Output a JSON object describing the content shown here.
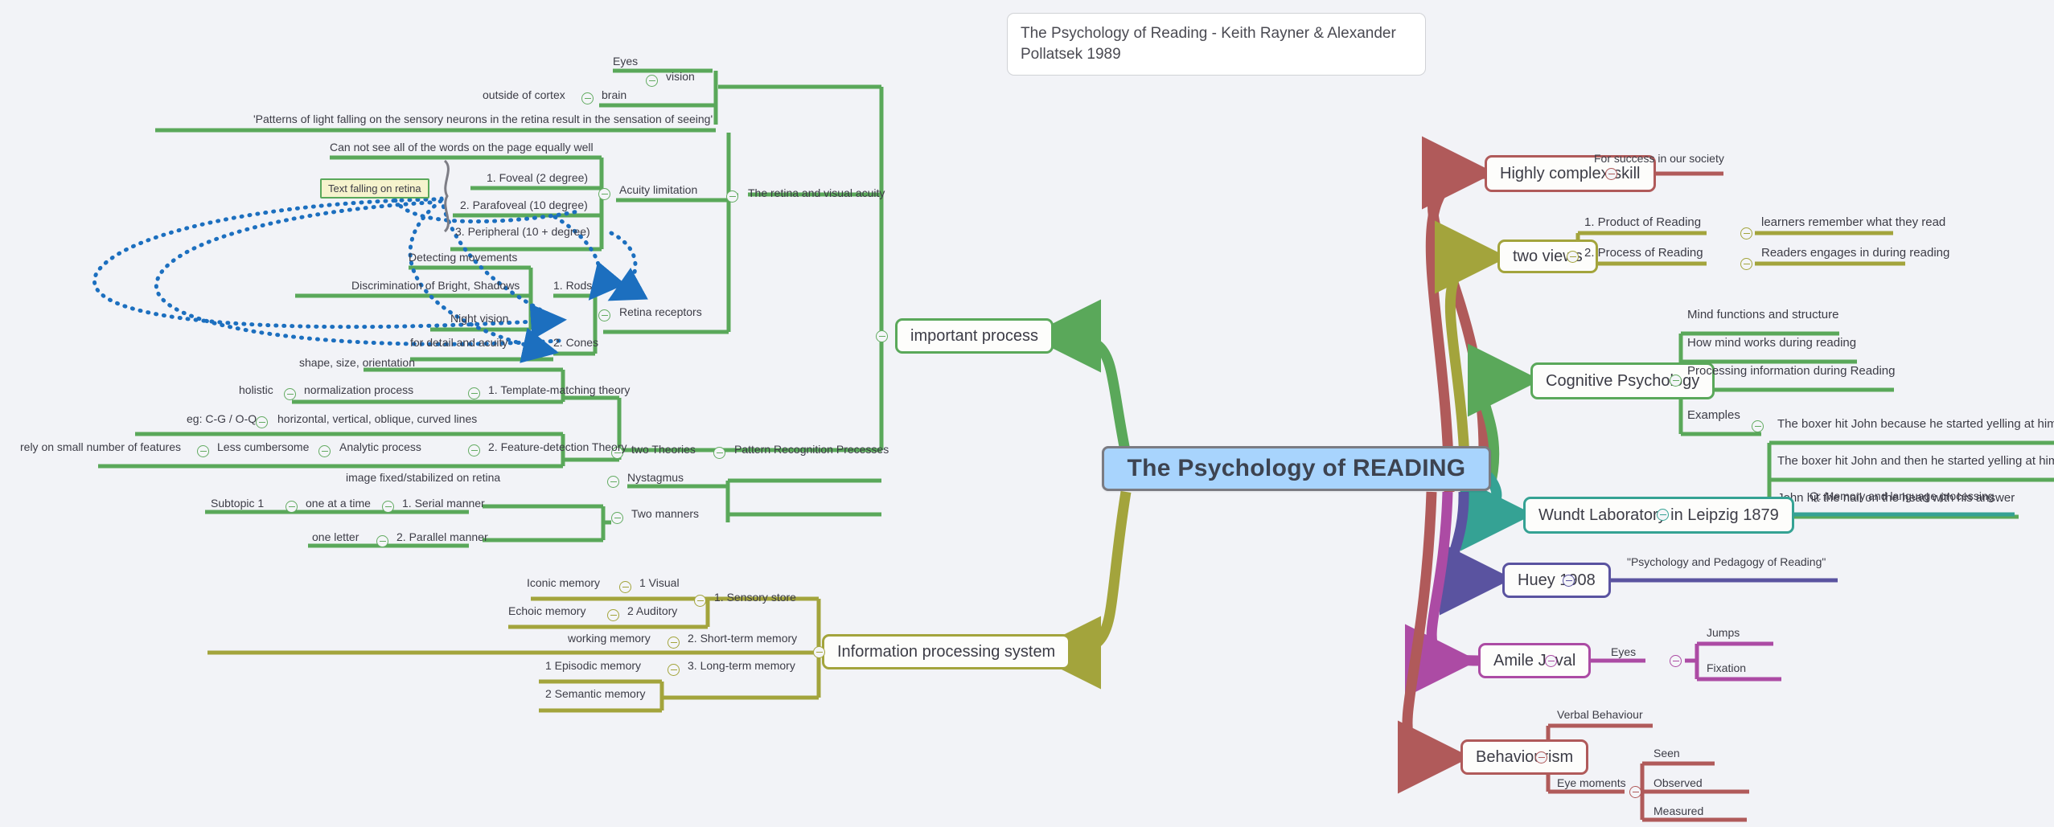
{
  "title_card": {
    "text": "The Psychology of Reading - Keith Rayner & Alexander Pollatsek 1989"
  },
  "root": {
    "label": "The Psychology of READING",
    "fill": "#a8d4fd",
    "border": "#7b7b82"
  },
  "colors": {
    "green": "#5aa85a",
    "olive": "#a3a43c",
    "red": "#b05a5a",
    "teal": "#35a294",
    "purple": "#5a53a0",
    "magenta": "#ac4ba4",
    "relation_blue": "#1c6fbf",
    "background": "#f2f3f7",
    "node_fill": "#fdfdfb",
    "note_fill": "#f6f3cd"
  },
  "right_branches": [
    {
      "label": "Highly complex skill",
      "color": "#b05a5a",
      "children": [
        {
          "label": "For success in our society"
        }
      ]
    },
    {
      "label": "two views",
      "color": "#a3a43c",
      "children": [
        {
          "label": "1. Product of Reading",
          "children": [
            {
              "label": "learners remember what they read"
            }
          ]
        },
        {
          "label": "2. Process of Reading",
          "children": [
            {
              "label": "Readers engages in during reading"
            }
          ]
        }
      ]
    },
    {
      "label": "Cognitive Psychology",
      "color": "#5aa85a",
      "children": [
        {
          "label": "Mind functions and structure"
        },
        {
          "label": "How mind works during reading"
        },
        {
          "label": "Processing information during Reading"
        },
        {
          "label": "Examples",
          "children": [
            {
              "label": "The boxer hit John because he started yelling at him"
            },
            {
              "label": "The boxer hit John and then he started yelling at him"
            },
            {
              "label": "John hit the nail on the head with his answer"
            }
          ]
        }
      ]
    },
    {
      "label": "Wundt Laboratory in Leipzig 1879",
      "color": "#35a294",
      "children": [
        {
          "label": "Q: Memory and language processing"
        }
      ]
    },
    {
      "label": "Huey 1908",
      "color": "#5a53a0",
      "children": [
        {
          "label": "\"Psychology and Pedagogy of Reading\""
        }
      ]
    },
    {
      "label": "Amile Javal",
      "color": "#ac4ba4",
      "children": [
        {
          "label": "Eyes",
          "children": [
            {
              "label": "Jumps"
            },
            {
              "label": "Fixation"
            }
          ]
        }
      ]
    },
    {
      "label": "Behaviourism",
      "color": "#b05a5a",
      "children": [
        {
          "label": "Verbal Behaviour"
        },
        {
          "label": "Eye moments",
          "children": [
            {
              "label": "Seen"
            },
            {
              "label": "Observed"
            },
            {
              "label": "Measured"
            }
          ]
        }
      ]
    }
  ],
  "left_branches": [
    {
      "label": "important process",
      "color": "#5aa85a",
      "children": [
        {
          "label": "vision",
          "children": [
            {
              "label": "brain",
              "children": [
                {
                  "label": "outside of cortex"
                },
                {
                  "label": "Eyes"
                }
              ]
            },
            {
              "label": "'Patterns of light falling on the sensory neurons in the retina result in the sensation of seeing'"
            }
          ]
        },
        {
          "label": "The retina and visual acuity",
          "children": [
            {
              "label": "Acuity limitation",
              "children": [
                {
                  "label": "Can not see all of the words on the page equally well"
                },
                {
                  "label": "1. Foveal (2 degree)"
                },
                {
                  "label": "2. Parafoveal (10 degree)"
                },
                {
                  "label": "3. Peripheral (10 + degree)"
                }
              ]
            },
            {
              "label": "Retina receptors",
              "children": [
                {
                  "label": "1. Rods",
                  "children": [
                    {
                      "label": "Detecting movements"
                    },
                    {
                      "label": "Discrimination of Bright, Shadows"
                    },
                    {
                      "label": "Night vision"
                    }
                  ]
                },
                {
                  "label": "2. Cones",
                  "children": [
                    {
                      "label": "for detail and acuity"
                    }
                  ]
                }
              ]
            }
          ]
        },
        {
          "label": "Pattern Recognition Precesses",
          "children": [
            {
              "label": "two Theories",
              "children": [
                {
                  "label": "1. Template-matching theory",
                  "children": [
                    {
                      "label": "shape, size, orientation"
                    },
                    {
                      "label": "normalization process",
                      "children": [
                        {
                          "label": "holistic"
                        }
                      ]
                    }
                  ]
                },
                {
                  "label": "2. Feature-detection Theory",
                  "children": [
                    {
                      "label": "horizontal, vertical, oblique, curved lines",
                      "children": [
                        {
                          "label": "eg: C-G / O-Q"
                        }
                      ]
                    },
                    {
                      "label": "Analytic process",
                      "children": [
                        {
                          "label": "Less cumbersome",
                          "children": [
                            {
                              "label": "rely on small number of features"
                            }
                          ]
                        }
                      ]
                    }
                  ]
                }
              ]
            }
          ]
        },
        {
          "label": "Nystagmus",
          "children": [
            {
              "label": "image fixed/stabilized on retina"
            }
          ]
        },
        {
          "label": "Two manners",
          "children": [
            {
              "label": "1. Serial manner",
              "children": [
                {
                  "label": "one at a time",
                  "children": [
                    {
                      "label": "Subtopic 1"
                    }
                  ]
                }
              ]
            },
            {
              "label": "2. Parallel manner",
              "children": [
                {
                  "label": "one letter"
                }
              ]
            }
          ]
        }
      ]
    },
    {
      "label": "Information processing system",
      "color": "#a3a43c",
      "children": [
        {
          "label": "1. Sensory store",
          "children": [
            {
              "label": "1 Visual",
              "children": [
                {
                  "label": "Iconic memory"
                }
              ]
            },
            {
              "label": "2 Auditory",
              "children": [
                {
                  "label": "Echoic memory"
                }
              ]
            }
          ]
        },
        {
          "label": "2. Short-term memory",
          "children": [
            {
              "label": "working memory"
            }
          ]
        },
        {
          "label": "3. Long-term memory",
          "children": [
            {
              "label": "1 Episodic memory"
            },
            {
              "label": "2 Semantic memory"
            }
          ]
        }
      ]
    }
  ],
  "note": {
    "label": "Text falling on retina"
  },
  "labels": {
    "eyes": "Eyes",
    "vision": "vision",
    "brain": "brain",
    "outside_of_cortex": "outside of cortex",
    "patterns_quote": "'Patterns of light falling on the sensory neurons in the retina result in the sensation of seeing'",
    "cannot_see": "Can not see all of the words on the page equally well",
    "foveal": "1. Foveal (2 degree)",
    "parafoveal": "2. Parafoveal (10 degree)",
    "peripheral": "3. Peripheral (10 + degree)",
    "acuity_limitation": "Acuity limitation",
    "retina_visual_acuity": "The retina and visual acuity",
    "detecting_movements": "Detecting movements",
    "discrimination": "Discrimination of Bright, Shadows",
    "night_vision": "Night vision",
    "rods": "1. Rods",
    "for_detail": "for detail and acuity",
    "cones": "2. Cones",
    "retina_receptors": "Retina receptors",
    "shape_size": "shape, size, orientation",
    "holistic": "holistic",
    "normalization": "normalization process",
    "template_matching": "1. Template-matching theory",
    "eg_cg": "eg: C-G / O-Q",
    "hvoc": "horizontal, vertical, oblique, curved lines",
    "feature_detection": "2. Feature-detection Theory",
    "rely_small": "rely on small number of features",
    "less_cumbersome": "Less cumbersome",
    "analytic": "Analytic process",
    "two_theories": "two Theories",
    "pattern_recognition": "Pattern Recognition Precesses",
    "image_fixed": "image fixed/stabilized on retina",
    "nystagmus": "Nystagmus",
    "subtopic1": "Subtopic 1",
    "one_at_a_time": "one at a time",
    "serial": "1. Serial manner",
    "two_manners": "Two manners",
    "one_letter": "one letter",
    "parallel": "2. Parallel manner",
    "important_process": "important process",
    "iconic": "Iconic memory",
    "visual1": "1 Visual",
    "sensory_store": "1. Sensory store",
    "echoic": "Echoic memory",
    "auditory2": "2 Auditory",
    "working_memory": "working memory",
    "short_term": "2. Short-term memory",
    "episodic": "1 Episodic memory",
    "semantic": "2 Semantic memory",
    "long_term": "3. Long-term memory",
    "info_processing": "Information processing system",
    "highly_complex": "Highly complex skill",
    "for_success": "For success in our society",
    "two_views": "two views",
    "product_of_reading": "1. Product of Reading",
    "learners_remember": "learners remember what they read",
    "process_of_reading": "2. Process of Reading",
    "readers_engages": "Readers engages in during reading",
    "mind_functions": "Mind functions and structure",
    "how_mind_works": "How mind works during reading",
    "processing_info": "Processing information during Reading",
    "examples": "Examples",
    "ex1": "The boxer hit John because he started yelling at him",
    "ex2": "The boxer hit John and then he started yelling at him",
    "ex3": "John hit the nail on the head with his answer",
    "cognitive_psychology": "Cognitive Psychology",
    "wundt": "Wundt Laboratory in Leipzig 1879",
    "q_memory": "Q: Memory and language processing",
    "huey": "Huey 1908",
    "huey_book": "\"Psychology and Pedagogy of Reading\"",
    "amile": "Amile Javal",
    "eyes2": "Eyes",
    "jumps": "Jumps",
    "fixation": "Fixation",
    "behaviourism": "Behaviourism",
    "verbal_behaviour": "Verbal Behaviour",
    "eye_moments": "Eye moments",
    "seen": "Seen",
    "observed": "Observed",
    "measured": "Measured"
  }
}
